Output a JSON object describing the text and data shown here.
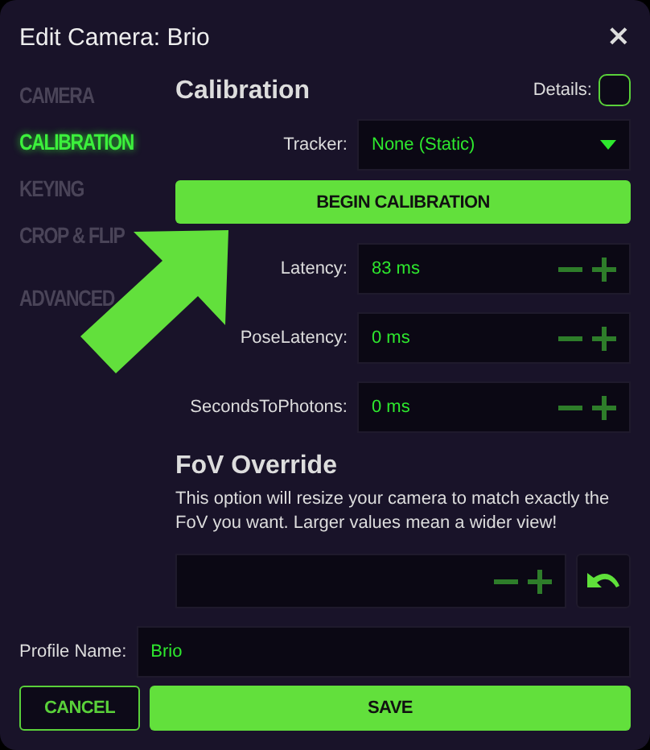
{
  "window": {
    "title": "Edit Camera: Brio",
    "close": "×"
  },
  "sidebar": {
    "items": [
      {
        "label": "CAMERA",
        "selected": false
      },
      {
        "label": "CALIBRATION",
        "selected": true
      },
      {
        "label": "KEYING",
        "selected": false
      },
      {
        "label": "CROP & FLIP",
        "selected": false
      },
      {
        "label": "ADVANCED",
        "selected": false
      }
    ]
  },
  "calibration": {
    "title": "Calibration",
    "details": {
      "label": "Details:",
      "checked": false
    },
    "tracker": {
      "label": "Tracker:",
      "value": "None (Static)"
    },
    "begin_button": "BEGIN CALIBRATION",
    "fields": [
      {
        "label": "Latency:",
        "value": "83 ms"
      },
      {
        "label": "PoseLatency:",
        "value": "0 ms"
      },
      {
        "label": "SecondsToPhotons:",
        "value": "0 ms"
      }
    ]
  },
  "fov_override": {
    "title": "FoV Override",
    "description": "This option will resize your camera to match exactly the FoV you want. Larger values mean a wider view!"
  },
  "profile_name": {
    "label": "Profile Name:",
    "value": "Brio"
  },
  "buttons": [
    {
      "label": "CANCEL",
      "kind": "secondary"
    },
    {
      "label": "SAVE",
      "kind": "primary"
    }
  ]
}
